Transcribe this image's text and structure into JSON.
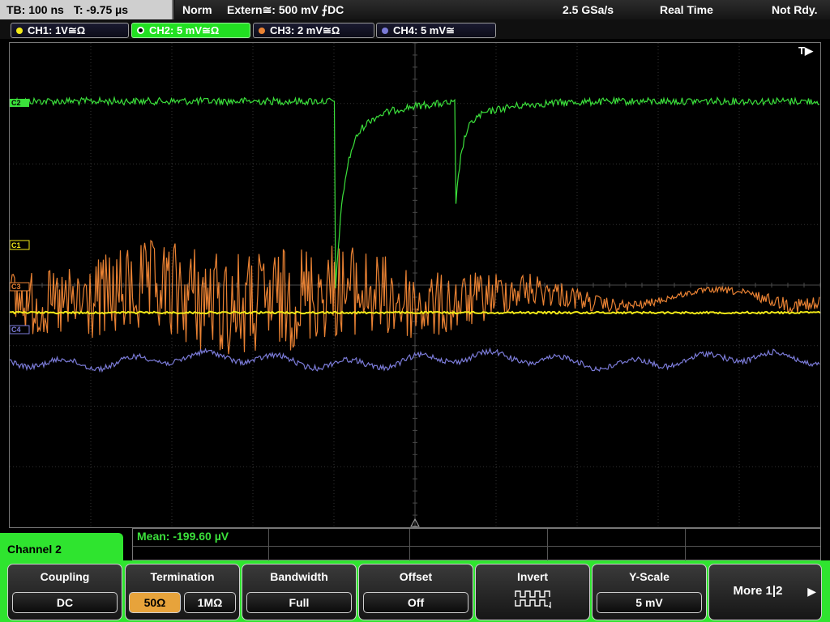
{
  "topbar": {
    "timebase": "TB: 100 ns",
    "trigger_time": "T: -9.75 µs",
    "mode": "Norm",
    "trigger_source": "Extern≅: 500 mV ⨍DC",
    "sample_rate": "2.5 GSa/s",
    "acq_mode": "Real Time",
    "status": "Not Rdy."
  },
  "channels": [
    {
      "label": "CH1: 1V≅Ω",
      "color": "#f2ea18"
    },
    {
      "label": "CH2: 5 mV≅Ω",
      "color": "#3be03b"
    },
    {
      "label": "CH3: 2 mV≅Ω",
      "color": "#ea8233"
    },
    {
      "label": "CH4: 5 mV≅",
      "color": "#7b7bd8"
    }
  ],
  "scope": {
    "trigger_marker": "T▶",
    "markers": [
      "C2",
      "C1",
      "C3",
      "C4"
    ]
  },
  "measurement": {
    "text": "Mean: -199.60 µV"
  },
  "menu": {
    "title": "Channel 2"
  },
  "softkeys": {
    "coupling": {
      "title": "Coupling",
      "value": "DC"
    },
    "termination": {
      "title": "Termination",
      "opt1": "50Ω",
      "opt2": "1MΩ",
      "selected": "50Ω"
    },
    "bandwidth": {
      "title": "Bandwidth",
      "value": "Full"
    },
    "offset": {
      "title": "Offset",
      "value": "Off"
    },
    "invert": {
      "title": "Invert"
    },
    "yscale": {
      "title": "Y-Scale",
      "value": "5 mV"
    },
    "more": {
      "label": "More 1|2"
    }
  }
}
